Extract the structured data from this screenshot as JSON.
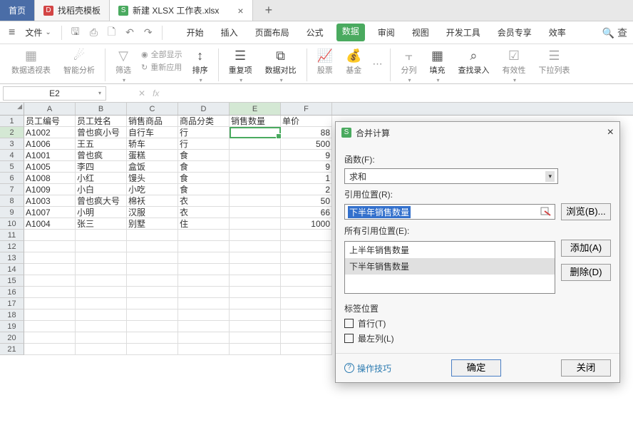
{
  "tabs": {
    "home": "首页",
    "template": "找稻壳模板",
    "current": "新建 XLSX 工作表.xlsx"
  },
  "file_menu": "文件",
  "menu_tabs": [
    "开始",
    "插入",
    "页面布局",
    "公式",
    "数据",
    "审阅",
    "视图",
    "开发工具",
    "会员专享",
    "效率"
  ],
  "search_label": "查",
  "ribbon": {
    "pivot": "数据透视表",
    "smart": "智能分析",
    "filter": "筛选",
    "show_all": "全部显示",
    "reapply": "重新应用",
    "sort": "排序",
    "dedup": "重复项",
    "compare": "数据对比",
    "stock": "股票",
    "fund": "基金",
    "split": "分列",
    "fill": "填充",
    "findin": "查找录入",
    "validate": "有效性",
    "dropdown": "下拉列表"
  },
  "namebox": "E2",
  "columns": [
    "A",
    "B",
    "C",
    "D",
    "E",
    "F"
  ],
  "headers": [
    "员工编号",
    "员工姓名",
    "销售商品",
    "商品分类",
    "销售数量",
    "单价"
  ],
  "rows": [
    {
      "id": "A1002",
      "name": "曾也疯小号",
      "prod": "自行车",
      "cat": "行",
      "qty": "",
      "price": "88"
    },
    {
      "id": "A1006",
      "name": "王五",
      "prod": "轿车",
      "cat": "行",
      "qty": "",
      "price": "500"
    },
    {
      "id": "A1001",
      "name": "曾也疯",
      "prod": "蛋糕",
      "cat": "食",
      "qty": "",
      "price": "9"
    },
    {
      "id": "A1005",
      "name": "李四",
      "prod": "盒饭",
      "cat": "食",
      "qty": "",
      "price": "9"
    },
    {
      "id": "A1008",
      "name": "小红",
      "prod": "馒头",
      "cat": "食",
      "qty": "",
      "price": "1"
    },
    {
      "id": "A1009",
      "name": "小白",
      "prod": "小吃",
      "cat": "食",
      "qty": "",
      "price": "2"
    },
    {
      "id": "A1003",
      "name": "曾也疯大号",
      "prod": "棉袄",
      "cat": "衣",
      "qty": "",
      "price": "50"
    },
    {
      "id": "A1007",
      "name": "小明",
      "prod": "汉服",
      "cat": "衣",
      "qty": "",
      "price": "66"
    },
    {
      "id": "A1004",
      "name": "张三",
      "prod": "别墅",
      "cat": "住",
      "qty": "",
      "price": "1000"
    }
  ],
  "dialog": {
    "title": "合并计算",
    "func_label": "函数(F):",
    "func_value": "求和",
    "ref_label": "引用位置(R):",
    "ref_value": "下半年销售数量",
    "browse": "浏览(B)...",
    "all_refs_label": "所有引用位置(E):",
    "refs": [
      "上半年销售数量",
      "下半年销售数量"
    ],
    "add": "添加(A)",
    "delete": "删除(D)",
    "labels_section": "标签位置",
    "top_row": "首行(T)",
    "left_col": "最左列(L)",
    "help": "操作技巧",
    "ok": "确定",
    "close": "关闭"
  }
}
